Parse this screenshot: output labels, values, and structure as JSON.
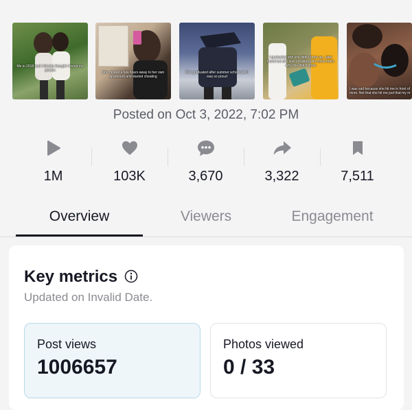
{
  "thumbnails": [
    {
      "caption": "Me in 2018 and I literally thought I found my person"
    },
    {
      "caption": "She moved a few hours away to her own apartment and started cheating"
    },
    {
      "caption": "She graduated after summer school and I was so proud"
    },
    {
      "caption": "I graduated and she didn't show up...later found out she was cheating with some that's why she didn't show"
    },
    {
      "caption": "I was sad because she hit me in front of mom. Not that she hit me just that my m"
    }
  ],
  "posted_text": "Posted on Oct 3, 2022, 7:02 PM",
  "stats": [
    {
      "icon": "play-icon",
      "value": "1M"
    },
    {
      "icon": "heart-icon",
      "value": "103K"
    },
    {
      "icon": "comment-icon",
      "value": "3,670"
    },
    {
      "icon": "share-icon",
      "value": "3,322"
    },
    {
      "icon": "bookmark-icon",
      "value": "7,511"
    }
  ],
  "tabs": [
    {
      "label": "Overview",
      "active": true
    },
    {
      "label": "Viewers",
      "active": false
    },
    {
      "label": "Engagement",
      "active": false
    }
  ],
  "key_metrics": {
    "title": "Key metrics",
    "updated": "Updated on Invalid Date.",
    "cards": [
      {
        "label": "Post views",
        "value": "1006657"
      },
      {
        "label": "Photos viewed",
        "value": "0 / 33"
      }
    ]
  },
  "colors": {
    "icon_gray": "#8a8b91",
    "active_card_bg": "#eef6fa",
    "active_card_border": "#b9d9e8"
  }
}
